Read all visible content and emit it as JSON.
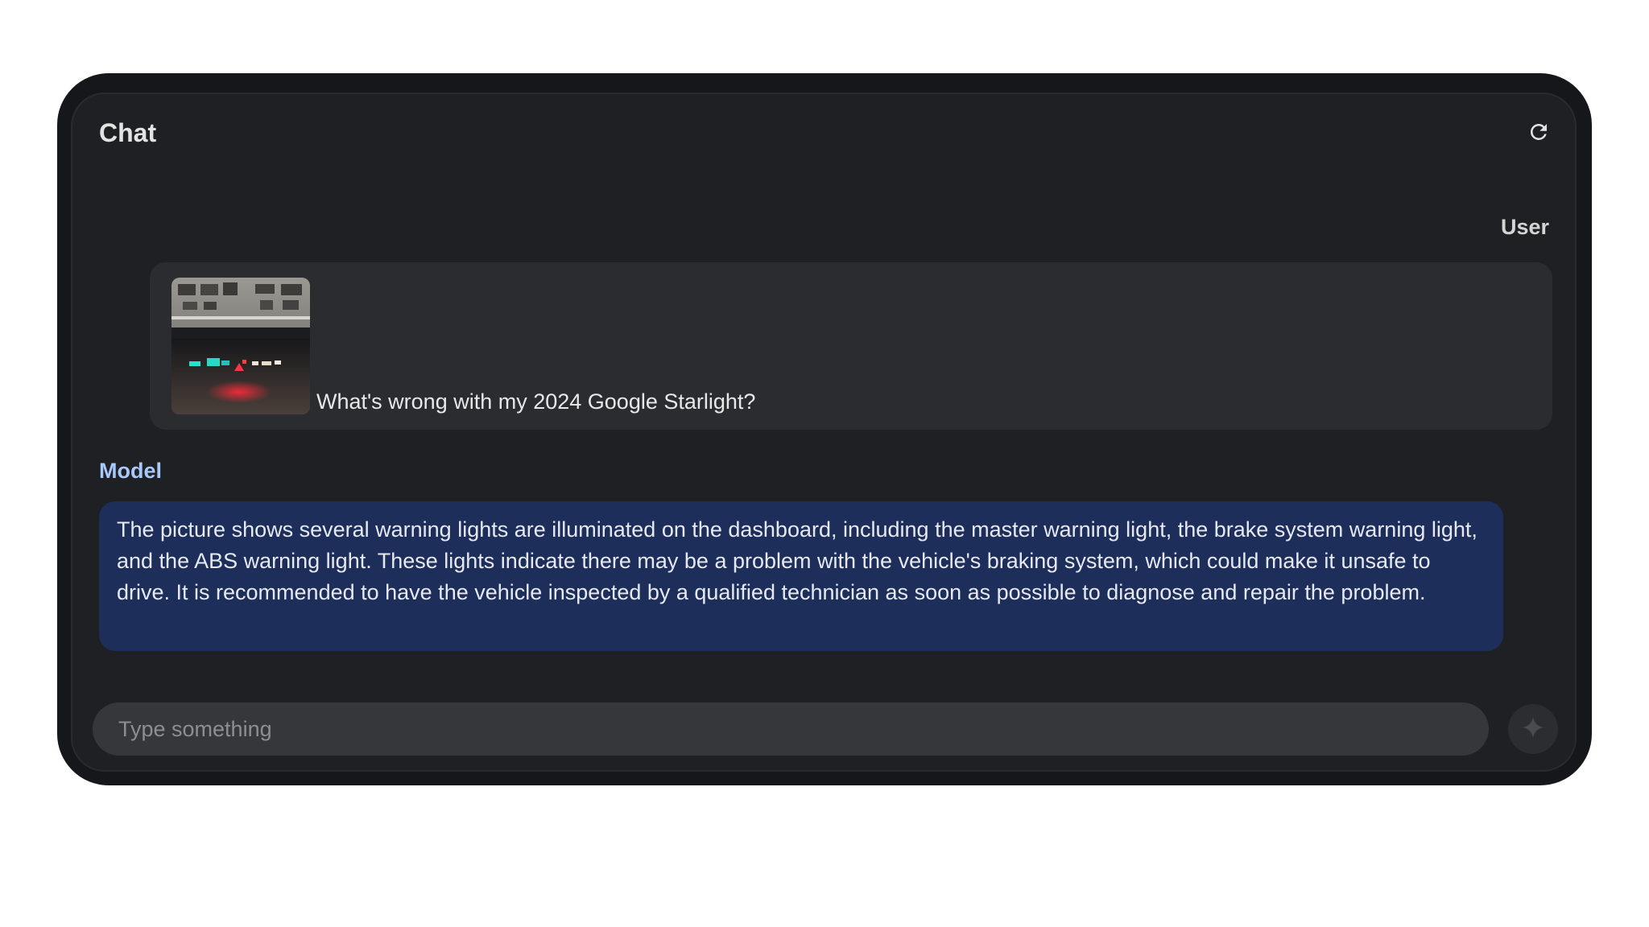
{
  "header": {
    "title": "Chat",
    "refresh_icon": "refresh-icon"
  },
  "messages": [
    {
      "role_label": "User",
      "has_image": true,
      "text": "What's wrong with my 2024 Google Starlight?"
    },
    {
      "role_label": "Model",
      "text": "The picture shows several warning lights are illuminated on the dashboard, including the master warning light, the brake system warning light, and the ABS warning light. These lights indicate there may be a problem with the vehicle's braking system, which could make it unsafe to drive. It is recommended to have the vehicle inspected by a qualified technician as soon as possible to diagnose and repair the problem."
    }
  ],
  "composer": {
    "placeholder": "Type something",
    "value": "",
    "send_icon": "sparkle-icon"
  },
  "colors": {
    "page_background": "#ffffff",
    "device_frame": "#16171a",
    "panel_background": "#1f2023",
    "user_bubble": "#2b2c30",
    "model_bubble": "#1d2e5b",
    "model_label": "#a8c7fa",
    "input_background": "#36373b"
  }
}
